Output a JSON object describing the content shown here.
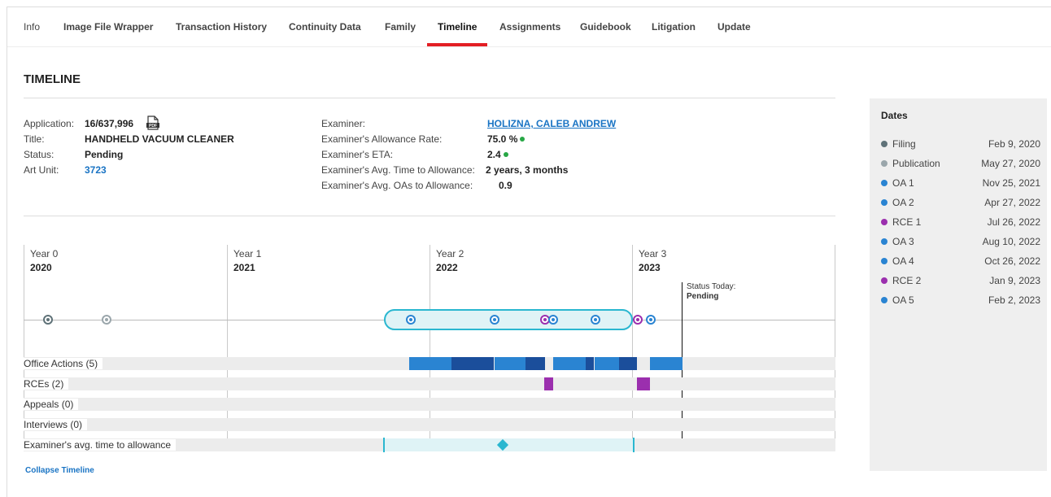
{
  "tabs": [
    {
      "label": "Info"
    },
    {
      "label": "Image File Wrapper"
    },
    {
      "label": "Transaction History"
    },
    {
      "label": "Continuity Data"
    },
    {
      "label": "Family"
    },
    {
      "label": "Timeline"
    },
    {
      "label": "Assignments"
    },
    {
      "label": "Guidebook"
    },
    {
      "label": "Litigation"
    },
    {
      "label": "Update"
    }
  ],
  "active_tab": "Timeline",
  "section_title": "TIMELINE",
  "application": {
    "application_label": "Application:",
    "application_value": "16/637,996",
    "title_label": "Title:",
    "title_value": "HANDHELD VACUUM CLEANER",
    "status_label": "Status:",
    "status_value": "Pending",
    "art_unit_label": "Art Unit:",
    "art_unit_value": "3723"
  },
  "examiner": {
    "examiner_label": "Examiner:",
    "examiner_value": "HOLIZNA, CALEB ANDREW",
    "allowance_rate_label": "Examiner's Allowance Rate:",
    "allowance_rate_value": "75.0 %",
    "eta_label": "Examiner's ETA:",
    "eta_value": "2.4",
    "avg_time_label": "Examiner's Avg. Time to Allowance:",
    "avg_time_value": "2 years, 3 months",
    "avg_oas_label": "Examiner's Avg. OAs to Allowance:",
    "avg_oas_value": "0.9",
    "indicator_color": "#27a745"
  },
  "dates_panel": {
    "title": "Dates",
    "items": [
      {
        "name": "Filing",
        "date": "Feb 9, 2020",
        "color": "#5f7278"
      },
      {
        "name": "Publication",
        "date": "May 27, 2020",
        "color": "#9aa6ab"
      },
      {
        "name": "OA 1",
        "date": "Nov 25, 2021",
        "color": "#2a84d2"
      },
      {
        "name": "OA 2",
        "date": "Apr 27, 2022",
        "color": "#2a84d2"
      },
      {
        "name": "RCE 1",
        "date": "Jul 26, 2022",
        "color": "#9b2fae"
      },
      {
        "name": "OA 3",
        "date": "Aug 10, 2022",
        "color": "#2a84d2"
      },
      {
        "name": "OA 4",
        "date": "Oct 26, 2022",
        "color": "#2a84d2"
      },
      {
        "name": "RCE 2",
        "date": "Jan 9, 2023",
        "color": "#9b2fae"
      },
      {
        "name": "OA 5",
        "date": "Feb 2, 2023",
        "color": "#2a84d2"
      }
    ]
  },
  "timeline": {
    "years": [
      {
        "label": "Year 0",
        "year": "2020"
      },
      {
        "label": "Year 1",
        "year": "2021"
      },
      {
        "label": "Year 2",
        "year": "2022"
      },
      {
        "label": "Year 3",
        "year": "2023"
      }
    ],
    "today_label": "Status Today:",
    "today_value": "Pending",
    "rows": {
      "office_actions": "Office Actions (5)",
      "rces": "RCEs (2)",
      "appeals": "Appeals (0)",
      "interviews": "Interviews (0)",
      "avg_time": "Examiner's avg. time to allowance"
    },
    "colors": {
      "oa_light": "#2a84d2",
      "oa_dark": "#1b4e9b",
      "rce": "#9b2fae",
      "avg": "#2ab7d0"
    }
  },
  "collapse_link": "Collapse Timeline"
}
